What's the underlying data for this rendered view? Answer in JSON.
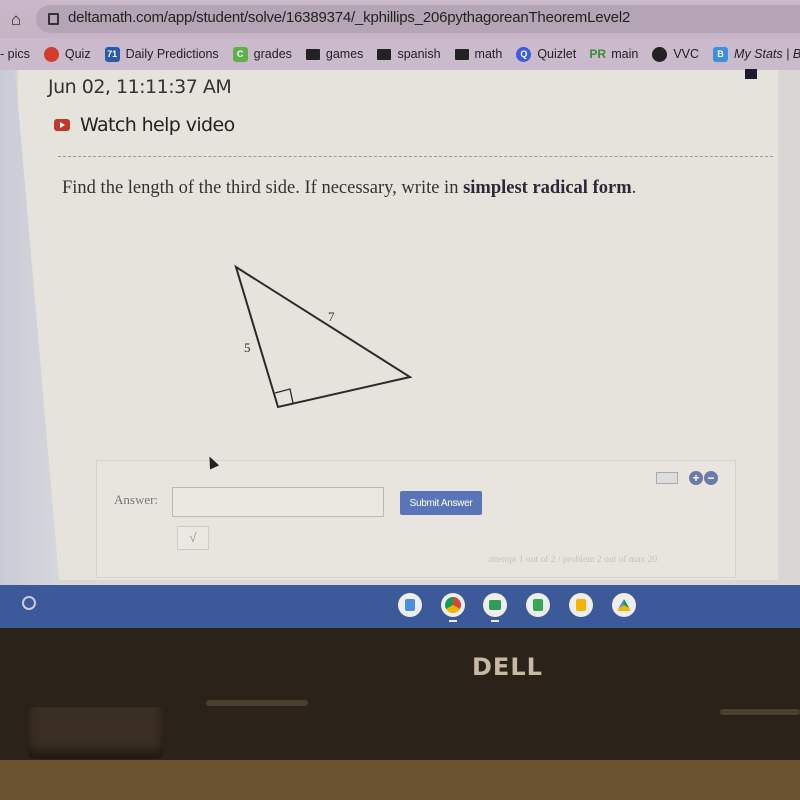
{
  "browser": {
    "url": "deltamath.com/app/student/solve/16389374/_kphillips_206pythagoreanTheoremLevel2",
    "bookmarks": [
      {
        "label": "- pics",
        "icon": "none"
      },
      {
        "label": "Quiz",
        "icon": "red-circle",
        "color": "#d33b2c"
      },
      {
        "label": "Daily Predictions",
        "icon": "square-71",
        "color": "#2b5aa8"
      },
      {
        "label": "grades",
        "icon": "square-c",
        "color": "#5db04a"
      },
      {
        "label": "games",
        "icon": "folder"
      },
      {
        "label": "spanish",
        "icon": "folder"
      },
      {
        "label": "math",
        "icon": "folder"
      },
      {
        "label": "Quizlet",
        "icon": "quizlet-q",
        "color": "#3e5bdb"
      },
      {
        "label": "main",
        "icon": "pr-logo",
        "color": "#3a8a3a"
      },
      {
        "label": "VVC",
        "icon": "globe",
        "color": "#222"
      },
      {
        "label": "My Stats | Blo",
        "icon": "square-b",
        "color": "#3d8fe0"
      }
    ]
  },
  "page": {
    "timestamp": "Jun 02, 11:11:37 AM",
    "help_video": "Watch help video",
    "prompt_plain": "Find the length of the third side. If necessary, write in ",
    "prompt_bold": "simplest radical form",
    "prompt_end": ".",
    "triangle": {
      "leg_label": "5",
      "hypotenuse_label": "7",
      "right_angle": true
    },
    "answer_label": "Answer:",
    "answer_value": "",
    "submit_label": "Submit Answer",
    "sqrt_label": "√",
    "attempt_text": "attempt 1 out of 2 / problem 2 out of max 20",
    "accent_color": "#5a74b8"
  },
  "shelf": {
    "apps": [
      "docs-icon",
      "chrome-icon",
      "classroom-icon",
      "sheets-icon",
      "slides-icon",
      "drive-icon"
    ]
  },
  "device": {
    "brand": "DELL"
  }
}
